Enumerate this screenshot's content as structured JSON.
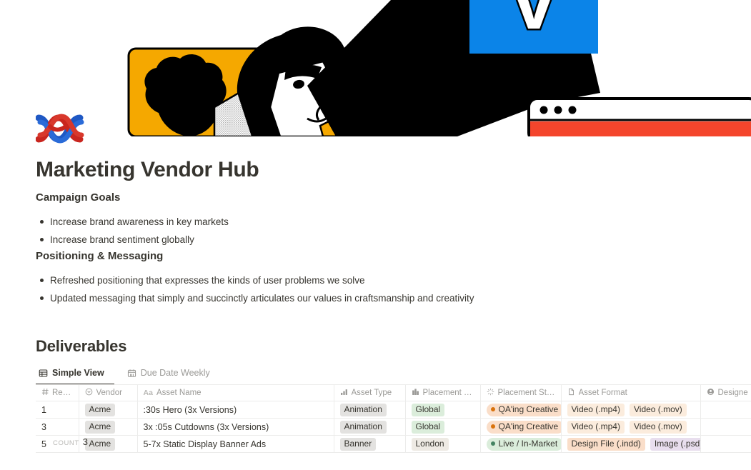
{
  "hero": {
    "alt": "marketing-illustration",
    "colors": {
      "orange_panel": "#F5A800",
      "blue_square": "#0B84E8",
      "red_browser": "#F4452C",
      "black": "#000000",
      "gray_stipple": "#C9C9C9"
    },
    "letter_glyph": "V"
  },
  "page": {
    "logo_icon": "braided-rope-icon",
    "title": "Marketing Vendor Hub"
  },
  "sections": [
    {
      "heading": "Campaign Goals",
      "bullets": [
        "Increase brand awareness in key markets",
        "Increase brand sentiment globally"
      ]
    },
    {
      "heading": "Positioning & Messaging",
      "bullets": [
        "Refreshed positioning that expresses the kinds of user problems we solve",
        "Updated messaging that simply and succinctly articulates our values in craftsmanship and creativity"
      ]
    }
  ],
  "deliverables": {
    "title": "Deliverables",
    "tabs": [
      {
        "label": "Simple View",
        "icon": "table-grid-icon",
        "active": true
      },
      {
        "label": "Due Date Weekly",
        "icon": "calendar-icon",
        "active": false
      }
    ],
    "table": {
      "columns": [
        {
          "label": "Refere...",
          "icon": "hash-icon"
        },
        {
          "label": "Vendor",
          "icon": "select-circle-icon"
        },
        {
          "label": "Asset Name",
          "icon": "text-aa-icon"
        },
        {
          "label": "Asset Type",
          "icon": "bar-chart-icon"
        },
        {
          "label": "Placement City",
          "icon": "building-icon"
        },
        {
          "label": "Placement Status",
          "icon": "spinner-icon"
        },
        {
          "label": "Asset Format",
          "icon": "file-icon"
        },
        {
          "label": "Designe",
          "icon": "person-circle-icon"
        }
      ],
      "rows": [
        {
          "reference": "1",
          "vendor": "Acme",
          "asset_name": ":30s Hero (3x Versions)",
          "asset_type": "Animation",
          "placement_city": "Global",
          "placement_city_color": "green",
          "placement_status": "QA'ing Creative",
          "placement_status_color": "orange",
          "asset_format": [
            {
              "label": "Video (.mp4)",
              "color": "yellow"
            },
            {
              "label": "Video (.mov)",
              "color": "yellow"
            }
          ],
          "designer": ""
        },
        {
          "reference": "3",
          "vendor": "Acme",
          "asset_name": "3x :05s Cutdowns (3x Versions)",
          "asset_type": "Animation",
          "placement_city": "Global",
          "placement_city_color": "green",
          "placement_status": "QA'ing Creative",
          "placement_status_color": "orange",
          "asset_format": [
            {
              "label": "Video (.mp4)",
              "color": "yellow"
            },
            {
              "label": "Video (.mov)",
              "color": "yellow"
            }
          ],
          "designer": ""
        },
        {
          "reference": "5",
          "vendor": "Acme",
          "asset_name": "5-7x Static Display Banner Ads",
          "asset_type": "Banner",
          "placement_city": "London",
          "placement_city_color": "beige",
          "placement_status": "Live / In-Market",
          "placement_status_color": "green",
          "asset_format": [
            {
              "label": "Design File (.indd)",
              "color": "orange"
            },
            {
              "label": "Image (.psd)",
              "color": "purple"
            }
          ],
          "designer": ""
        }
      ],
      "footer": {
        "label": "COUNT",
        "value": "3"
      }
    }
  }
}
